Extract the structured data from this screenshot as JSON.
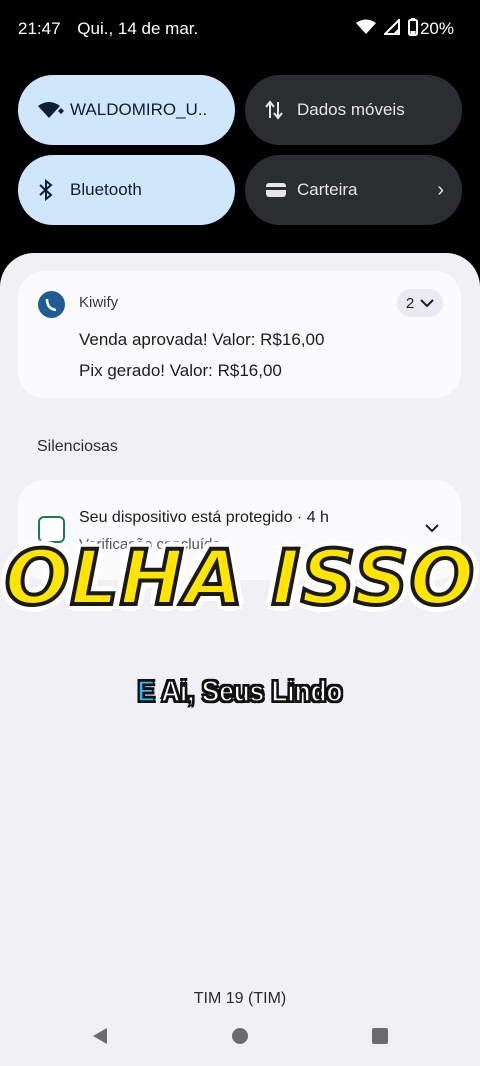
{
  "status": {
    "time": "21:47",
    "date": "Qui., 14 de mar.",
    "battery": "20%"
  },
  "quick_tiles": [
    {
      "label": "WALDOMIRO_U..",
      "icon": "wifi-icon",
      "state": "on"
    },
    {
      "label": "Dados móveis",
      "icon": "mobile-data-icon",
      "state": "off"
    },
    {
      "label": "Bluetooth",
      "icon": "bluetooth-icon",
      "state": "on"
    },
    {
      "label": "Carteira",
      "icon": "wallet-icon",
      "state": "off"
    }
  ],
  "notification": {
    "app": "Kiwify",
    "count": "2",
    "lines": [
      "Venda aprovada! Valor: R$16,00",
      "Pix gerado! Valor: R$16,00"
    ]
  },
  "silent_section": {
    "label": "Silenciosas",
    "title": "Seu dispositivo está protegido · 4 h",
    "subtitle": "Verificação concluída"
  },
  "overlay": {
    "title": "OLHA ISSO",
    "caption_highlight": "E",
    "caption_rest": " Ai, Seus Lindo"
  },
  "carrier": "TIM 19 (TIM)",
  "colors": {
    "tile_on": "#cfe6fb",
    "tile_off": "#2b2d31",
    "overlay_yellow": "#ffe500",
    "caption_blue": "#39b3ff"
  }
}
